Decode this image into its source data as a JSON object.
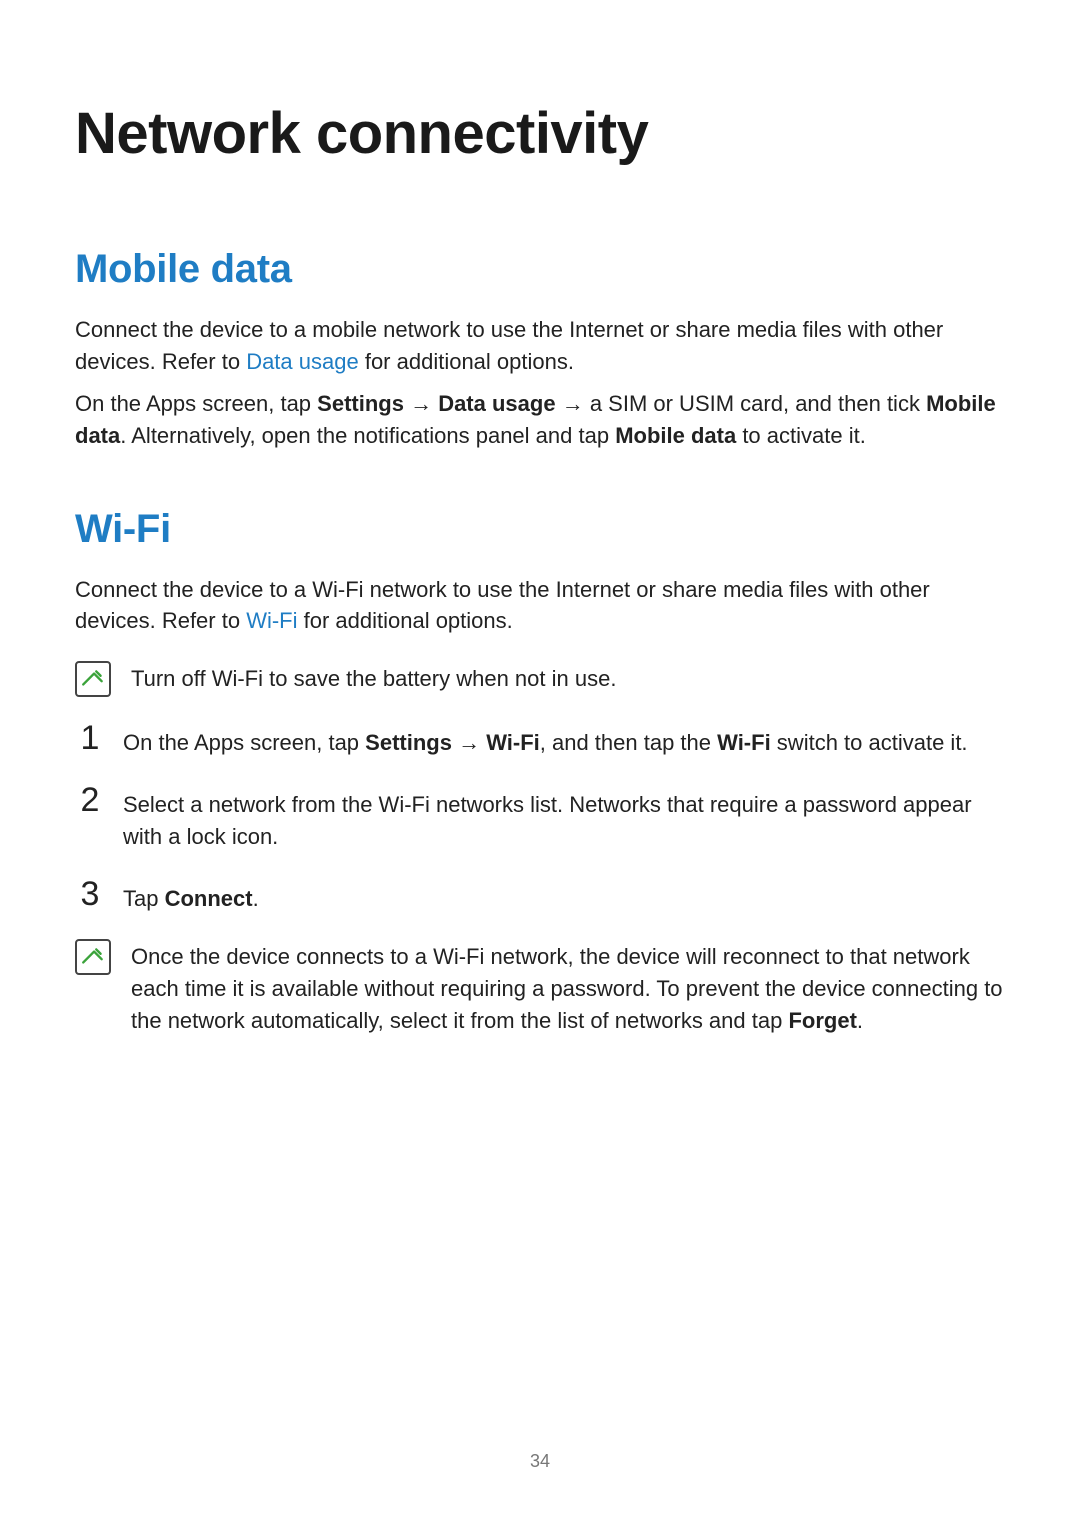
{
  "page_number": "34",
  "chapter_title": "Network connectivity",
  "sections": {
    "mobile_data": {
      "title": "Mobile data",
      "p1_a": "Connect the device to a mobile network to use the Internet or share media files with other devices. Refer to ",
      "p1_link": "Data usage",
      "p1_b": " for additional options.",
      "p2_a": "On the Apps screen, tap ",
      "p2_b1": "Settings",
      "p2_arrow1": " → ",
      "p2_b2": "Data usage",
      "p2_arrow2": " → ",
      "p2_c": "a SIM or USIM card, and then tick ",
      "p2_b3": "Mobile data",
      "p2_d": ". Alternatively, open the notifications panel and tap ",
      "p2_b4": "Mobile data",
      "p2_e": " to activate it."
    },
    "wifi": {
      "title": "Wi-Fi",
      "p1_a": "Connect the device to a Wi-Fi network to use the Internet or share media files with other devices. Refer to ",
      "p1_link": "Wi-Fi",
      "p1_b": " for additional options.",
      "note1": "Turn off Wi-Fi to save the battery when not in use.",
      "steps": {
        "s1_num": "1",
        "s1_a": "On the Apps screen, tap ",
        "s1_b1": "Settings",
        "s1_arrow": " → ",
        "s1_b2": "Wi-Fi",
        "s1_c": ", and then tap the ",
        "s1_b3": "Wi-Fi",
        "s1_d": " switch to activate it.",
        "s2_num": "2",
        "s2": "Select a network from the Wi-Fi networks list. Networks that require a password appear with a lock icon.",
        "s3_num": "3",
        "s3_a": "Tap ",
        "s3_b": "Connect",
        "s3_c": "."
      },
      "note2_a": "Once the device connects to a Wi-Fi network, the device will reconnect to that network each time it is available without requiring a password. To prevent the device connecting to the network automatically, select it from the list of networks and tap ",
      "note2_b": "Forget",
      "note2_c": "."
    }
  }
}
